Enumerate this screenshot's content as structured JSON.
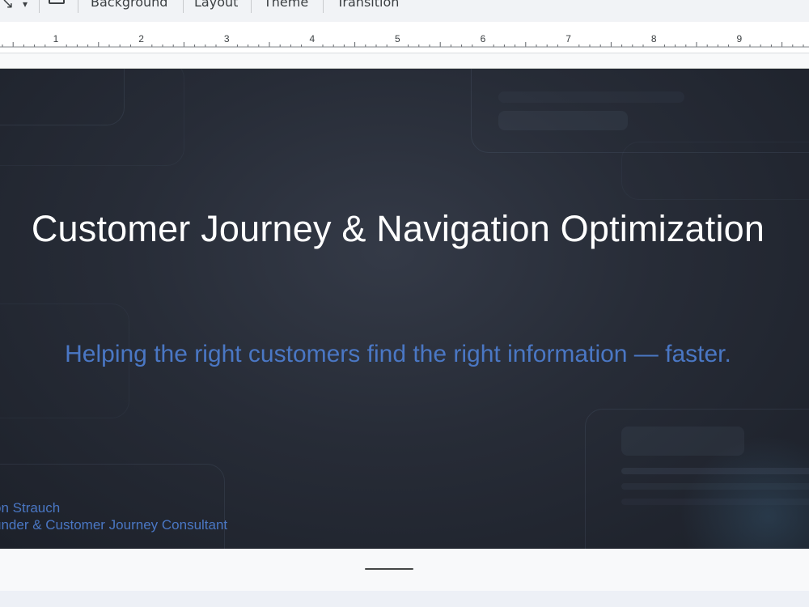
{
  "toolbar": {
    "buttons": [
      "Background",
      "Layout",
      "Theme",
      "Transition"
    ]
  },
  "ruler": {
    "marks": [
      "1",
      "2",
      "3",
      "4",
      "5",
      "6",
      "7",
      "8",
      "9"
    ]
  },
  "slide": {
    "title": "Customer Journey & Navigation Optimization",
    "subtitle": "Helping the right customers find the right information — faster.",
    "author_name": "on Strauch",
    "author_role": "under & Customer Journey Consultant",
    "colors": {
      "title": "#ffffff",
      "accent": "#4a77c4",
      "background": "#272c37"
    }
  }
}
